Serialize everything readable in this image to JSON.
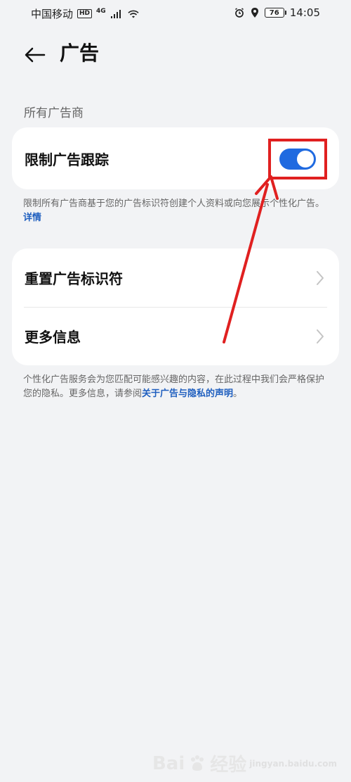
{
  "status_bar": {
    "carrier": "中国移动",
    "hd": "HD",
    "network": "4G",
    "battery": "76",
    "time": "14:05"
  },
  "header": {
    "title": "广告"
  },
  "section": {
    "all_advertisers": "所有广告商"
  },
  "ad_tracking": {
    "label": "限制广告跟踪",
    "enabled": true,
    "description_prefix": "限制所有广告商基于您的广告标识符创建个人资料或向您展示个性化广告。",
    "details_link": "详情"
  },
  "settings_list": [
    {
      "label": "重置广告标识符"
    },
    {
      "label": "更多信息"
    }
  ],
  "bottom_note": {
    "text_prefix": "个性化广告服务会为您匹配可能感兴趣的内容，在此过程中我们会严格保护您的隐私。更多信息，请参阅",
    "link": "关于广告与隐私的声明",
    "text_suffix": "。"
  },
  "watermark": {
    "brand": "Bai",
    "suffix": "经验",
    "subtext": "jingyan.baidu.com"
  },
  "colors": {
    "accent": "#1f6ae0",
    "annotation": "#e02020",
    "background": "#f2f3f5"
  }
}
